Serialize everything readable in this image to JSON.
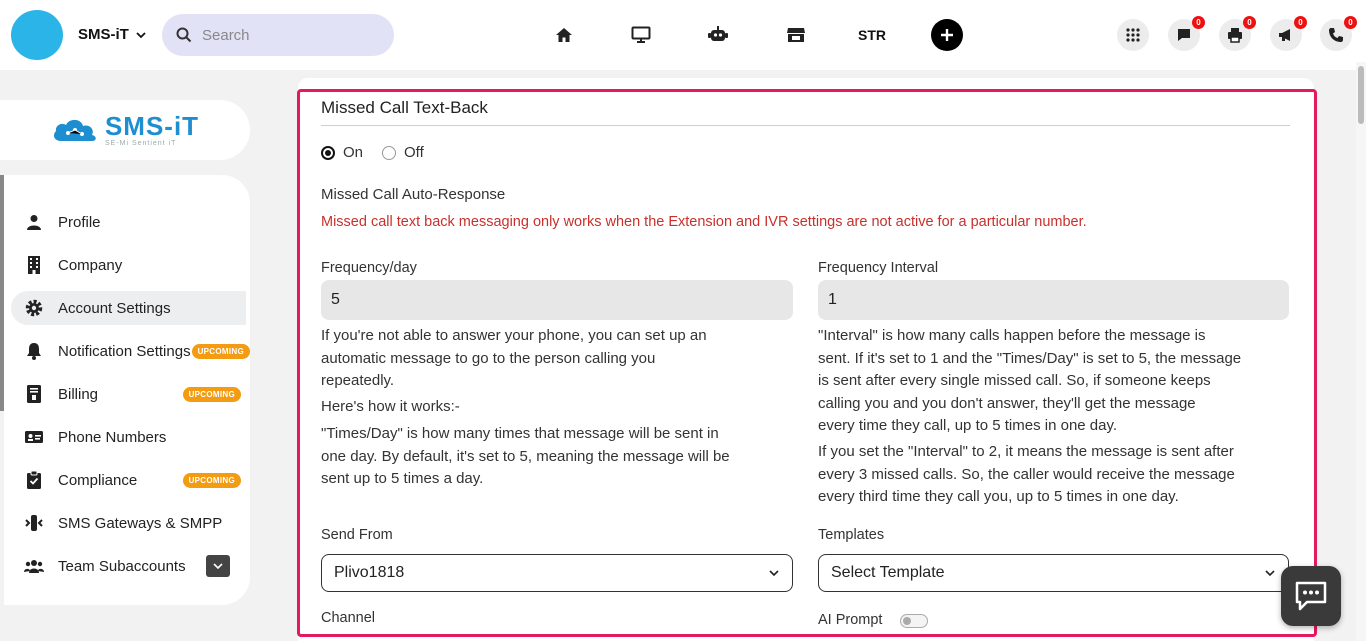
{
  "header": {
    "brand_name": "SMS-iT",
    "search_placeholder": "Search",
    "nav_icons": [
      "home-icon",
      "desktop-icon",
      "robot-icon",
      "store-icon"
    ],
    "str_label": "STR",
    "badges": {
      "messages": "0",
      "print": "0",
      "announcements": "0",
      "calls": "0"
    }
  },
  "sidebar": {
    "logo_text": "SMS-iT",
    "logo_subtext": "SE-Mi Sentient iT",
    "items": [
      {
        "label": "Profile",
        "icon": "person-icon"
      },
      {
        "label": "Company",
        "icon": "building-icon"
      },
      {
        "label": "Account Settings",
        "icon": "gear-icon",
        "active": true
      },
      {
        "label": "Notification Settings",
        "icon": "bell-icon",
        "pill": "UPCOMING"
      },
      {
        "label": "Billing",
        "icon": "invoice-icon",
        "pill": "UPCOMING"
      },
      {
        "label": "Phone Numbers",
        "icon": "id-card-icon"
      },
      {
        "label": "Compliance",
        "icon": "clipboard-icon",
        "pill": "UPCOMING"
      },
      {
        "label": "SMS Gateways & SMPP",
        "icon": "gateway-icon"
      },
      {
        "label": "Team Subaccounts",
        "icon": "team-icon"
      }
    ]
  },
  "form": {
    "section_title": "Missed Call Text-Back",
    "radio_on": "On",
    "radio_off": "Off",
    "auto_response_label": "Missed Call Auto-Response",
    "warning": "Missed call text back messaging only works when the Extension and IVR settings are not active for a particular number.",
    "frequency_day_label": "Frequency/day",
    "frequency_day_value": "5",
    "frequency_interval_label": "Frequency Interval",
    "frequency_interval_value": "1",
    "left_help": [
      "If you're not able to answer your phone, you can set up an",
      "automatic message to go to the person calling you",
      "repeatedly."
    ],
    "left_howto": "Here's how it works:-",
    "left_help2": [
      "\"Times/Day\" is how many times that message will be sent in",
      "one day. By default, it's set to 5, meaning the message will be",
      "sent up to 5 times a day."
    ],
    "right_help": [
      "\"Interval\" is how many calls happen before the message is",
      "sent. If it's set to 1 and the \"Times/Day\" is set to 5, the message",
      "is sent after every single missed call. So, if someone keeps",
      "calling you and you don't answer, they'll get the message",
      "every time they call, up to 5 times in one day."
    ],
    "right_help2": [
      "If you set the \"Interval\" to 2, it means the message is sent after",
      "every 3 missed calls. So, the caller would receive the message",
      "every third time they call you, up to 5 times in one day."
    ],
    "send_from_label": "Send From",
    "send_from_value": "Plivo1818",
    "templates_label": "Templates",
    "templates_value": "Select Template",
    "channel_label": "Channel",
    "ai_prompt_label": "AI Prompt"
  }
}
